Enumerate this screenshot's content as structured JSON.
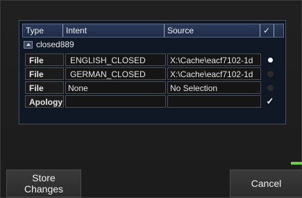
{
  "table": {
    "headers": {
      "type": "Type",
      "intent": "Intent",
      "source": "Source",
      "check": "✓"
    },
    "group_label": "closed889",
    "rows": [
      {
        "type": "File",
        "intent": "ENGLISH_CLOSED",
        "source": "X:\\Cache\\eacf7102-1d",
        "selected": true,
        "checked": false
      },
      {
        "type": "File",
        "intent": "GERMAN_CLOSED",
        "source": "X:\\Cache\\eacf7102-1d",
        "selected": false,
        "checked": false
      },
      {
        "type": "File",
        "intent": "None",
        "source": "No Selection",
        "selected": false,
        "checked": false
      },
      {
        "type": "Apology",
        "intent": "",
        "source": "",
        "selected": false,
        "checked": true
      }
    ]
  },
  "buttons": {
    "store_label": "Store\nChanges",
    "cancel_label": "Cancel"
  },
  "colors": {
    "accent": "#6ccf4c",
    "panel_bg": "#101725",
    "header_bg": "#2b3a5a"
  }
}
